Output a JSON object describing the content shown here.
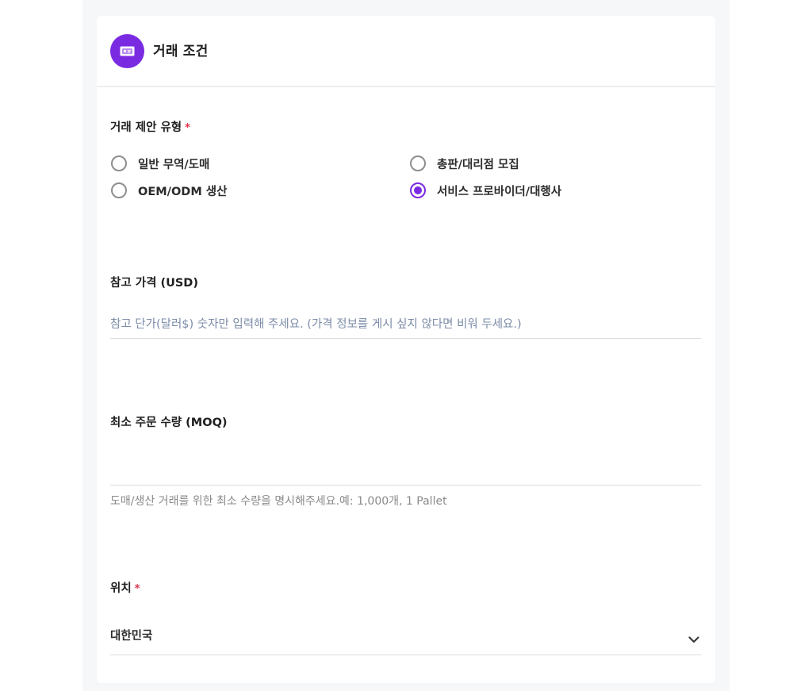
{
  "header": {
    "title": "거래 조건",
    "icon": "price-tag-icon",
    "accent_color": "#7a2be2"
  },
  "trade_type": {
    "label": "거래 제안 유형",
    "required_mark": "*",
    "options": [
      {
        "label": "일반 무역/도매",
        "checked": false
      },
      {
        "label": "총판/대리점 모집",
        "checked": false
      },
      {
        "label": "OEM/ODM 생산",
        "checked": false
      },
      {
        "label": "서비스 프로바이더/대행사",
        "checked": true
      }
    ]
  },
  "reference_price": {
    "label": "참고 가격 (USD)",
    "value": "",
    "placeholder": "참고 단가(달러$) 숫자만 입력해 주세요. (가격 정보를 게시 싶지 않다면 비워 두세요.)"
  },
  "moq": {
    "label": "최소 주문 수량 (MOQ)",
    "value": "",
    "helper": "도매/생산 거래를 위한 최소 수량을 명시해주세요.예: 1,000개, 1 Pallet"
  },
  "location": {
    "label": "위치",
    "required_mark": "*",
    "selected": "대한민국"
  }
}
